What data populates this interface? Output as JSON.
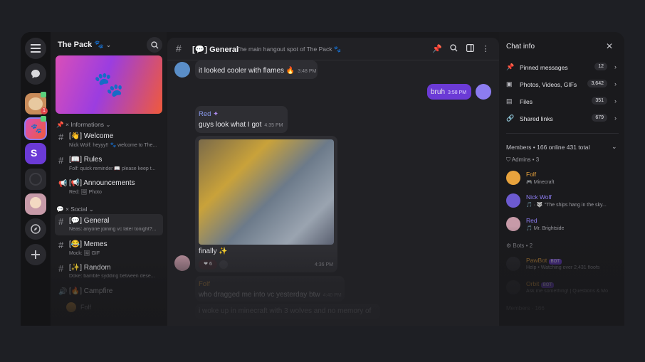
{
  "server": {
    "name": "The Pack 🐾",
    "categories": [
      {
        "label": "📌 × Informations"
      },
      {
        "label": "💬 × Social"
      }
    ],
    "channels": [
      {
        "name": "[👋] Welcome",
        "preview": "Nick Wolf: heyyy!! 🐾 welcome to The..."
      },
      {
        "name": "[📖] Rules",
        "preview": "Folf: quick reminder 📖 please keep t..."
      },
      {
        "name": "[📢] Announcements",
        "preview": "Red: 🖼 Photo"
      },
      {
        "name": "[💬] General",
        "preview": "Neas: anyone joining vc later tonight?..."
      },
      {
        "name": "[😂] Memes",
        "preview": "Mock: 🖼 GIF"
      },
      {
        "name": "[✨] Random",
        "preview": "Doke: bamble sydding between dese..."
      },
      {
        "name": "[🔥] Campfire",
        "preview": ""
      }
    ],
    "voice_user": "Folf"
  },
  "rail": {
    "badge_count": "1"
  },
  "chat": {
    "title": "[💬] General",
    "description": "The main hangout spot of The Pack 🐾",
    "messages": [
      {
        "text": "it looked cooler with flames 🔥",
        "time": "3:48 PM"
      },
      {
        "text": "bruh",
        "time": "3:58 PM"
      },
      {
        "name": "Red",
        "text": "guys look what I got",
        "time": "4:35 PM"
      },
      {
        "caption": "finally ✨",
        "reaction_count": "6",
        "time": "4:36 PM"
      },
      {
        "name": "Folf",
        "text": "who dragged me into vc yesterday btw",
        "time": "4:40 PM"
      },
      {
        "text": "i woke up in minecraft with 3 wolves and no memory of"
      }
    ]
  },
  "info": {
    "title": "Chat info",
    "rows": [
      {
        "label": "Pinned messages",
        "count": "12"
      },
      {
        "label": "Photos, Videos, GIFs",
        "count": "3,642"
      },
      {
        "label": "Files",
        "count": "351"
      },
      {
        "label": "Shared links",
        "count": "679"
      }
    ],
    "members_header": "Members",
    "members_online": "166 online",
    "members_total": "431 total",
    "admins_label": "Admins",
    "admins_count": "3",
    "members": [
      {
        "name": "Folf",
        "status": "🎮 Minecraft",
        "color": "#e8a33d"
      },
      {
        "name": "Nick Wolf",
        "status": "🎵 · 🐺 \"The ships hang in the sky...",
        "color": "#8c7cf0"
      },
      {
        "name": "Red",
        "status": "🎵 Mr. Brightside",
        "color": "#8c7cf0"
      }
    ],
    "bots_label": "Bots",
    "bots_count": "2",
    "bots": [
      {
        "name": "PawBot",
        "tag": "BOT",
        "status": "Help • Watching over 2,431 floofs"
      },
      {
        "name": "Orbit",
        "tag": "BOT",
        "status": "Ask me something! | Questions & Mo"
      }
    ],
    "footer": "Members · 166"
  }
}
